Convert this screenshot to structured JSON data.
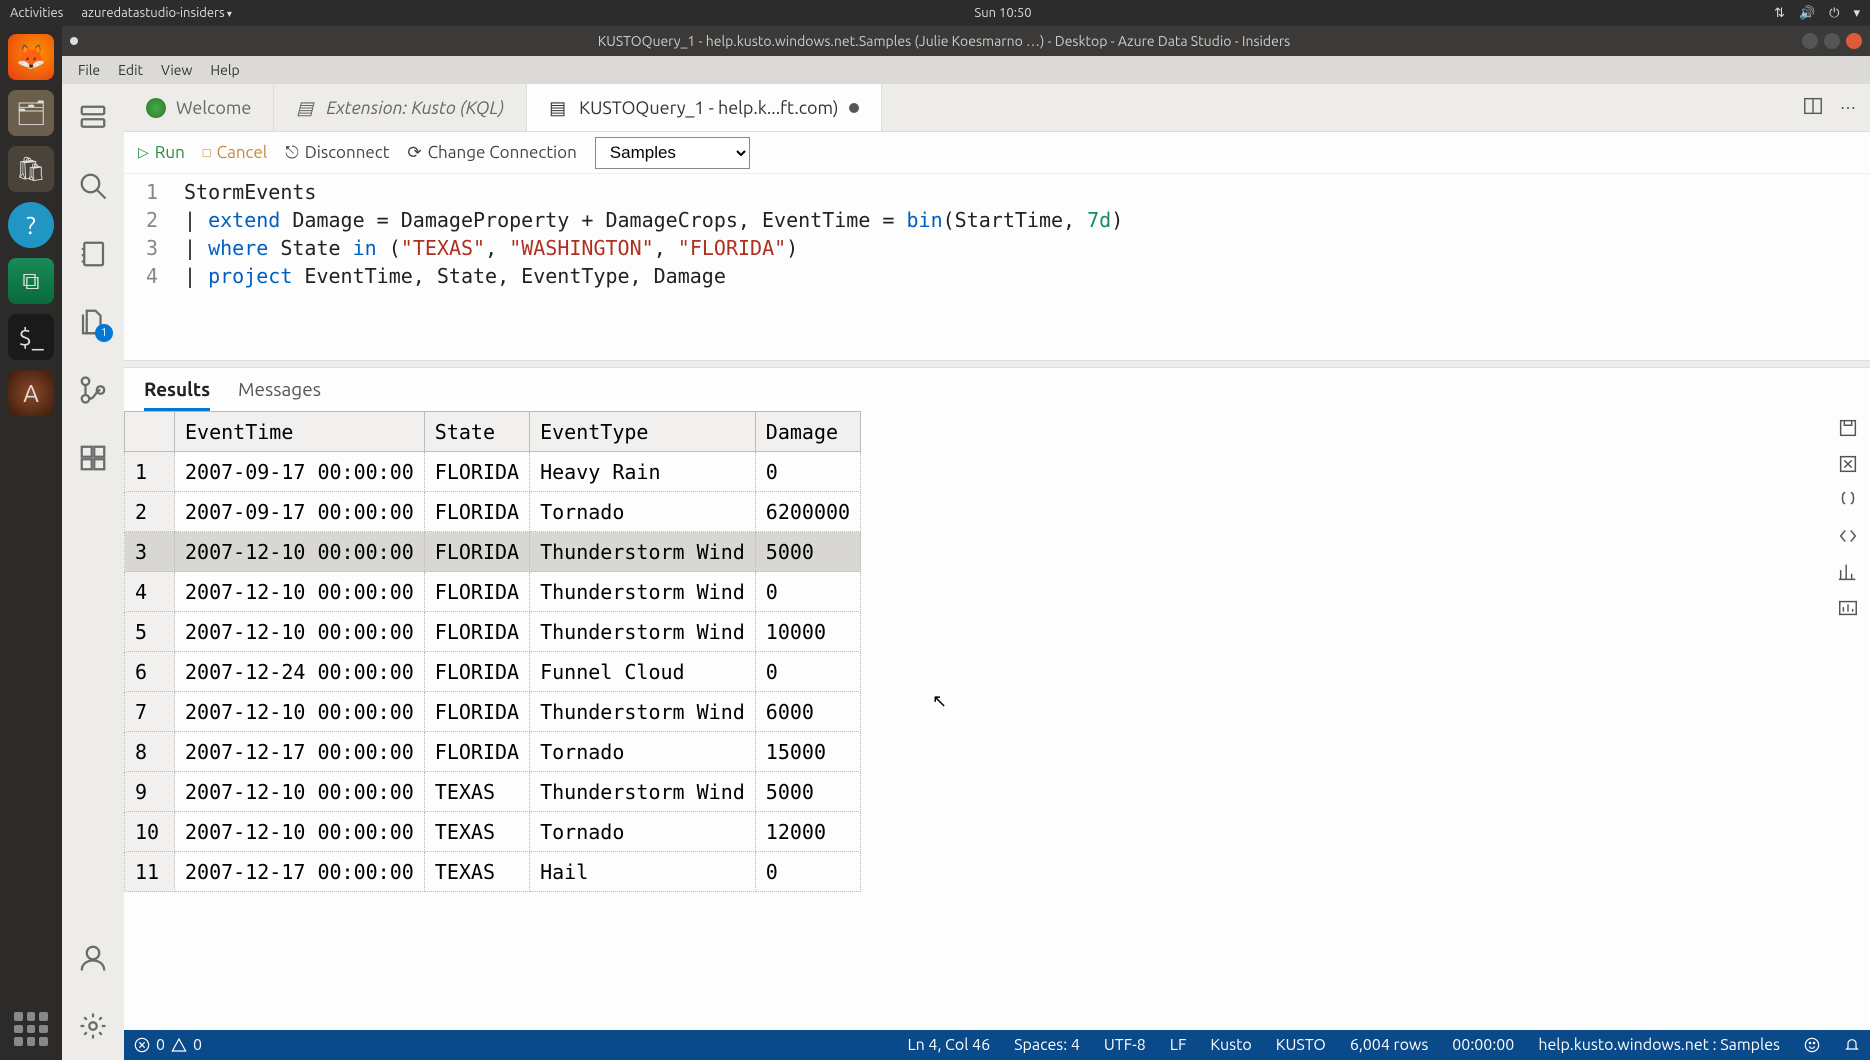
{
  "gnome": {
    "activities": "Activities",
    "app_menu": "azuredatastudio-insiders",
    "clock": "Sun 10:50"
  },
  "window": {
    "title": "KUSTOQuery_1 - help.kusto.windows.net.Samples (Julie Koesmarno …) - Desktop - Azure Data Studio - Insiders"
  },
  "menubar": [
    "File",
    "Edit",
    "View",
    "Help"
  ],
  "tabs": [
    {
      "label": "Welcome",
      "italic": false,
      "active": false,
      "dirty": false
    },
    {
      "label": "Extension: Kusto (KQL)",
      "italic": true,
      "active": false,
      "dirty": false
    },
    {
      "label": "KUSTOQuery_1 - help.k...ft.com)",
      "italic": false,
      "active": true,
      "dirty": true
    }
  ],
  "toolbar": {
    "run": "Run",
    "cancel": "Cancel",
    "disconnect": "Disconnect",
    "change_conn": "Change Connection",
    "db": "Samples"
  },
  "code_lines_raw": [
    "StormEvents",
    "| extend Damage = DamageProperty + DamageCrops, EventTime = bin(StartTime, 7d)",
    "| where State in (\"TEXAS\", \"WASHINGTON\", \"FLORIDA\")",
    "| project EventTime, State, EventType, Damage"
  ],
  "result_tabs": {
    "results": "Results",
    "messages": "Messages"
  },
  "grid": {
    "columns": [
      "EventTime",
      "State",
      "EventType",
      "Damage"
    ],
    "rows": [
      [
        "2007-09-17 00:00:00",
        "FLORIDA",
        "Heavy Rain",
        "0"
      ],
      [
        "2007-09-17 00:00:00",
        "FLORIDA",
        "Tornado",
        "6200000"
      ],
      [
        "2007-12-10 00:00:00",
        "FLORIDA",
        "Thunderstorm Wind",
        "5000"
      ],
      [
        "2007-12-10 00:00:00",
        "FLORIDA",
        "Thunderstorm Wind",
        "0"
      ],
      [
        "2007-12-10 00:00:00",
        "FLORIDA",
        "Thunderstorm Wind",
        "10000"
      ],
      [
        "2007-12-24 00:00:00",
        "FLORIDA",
        "Funnel Cloud",
        "0"
      ],
      [
        "2007-12-10 00:00:00",
        "FLORIDA",
        "Thunderstorm Wind",
        "6000"
      ],
      [
        "2007-12-17 00:00:00",
        "FLORIDA",
        "Tornado",
        "15000"
      ],
      [
        "2007-12-10 00:00:00",
        "TEXAS",
        "Thunderstorm Wind",
        "5000"
      ],
      [
        "2007-12-10 00:00:00",
        "TEXAS",
        "Tornado",
        "12000"
      ],
      [
        "2007-12-17 00:00:00",
        "TEXAS",
        "Hail",
        "0"
      ]
    ],
    "selected_row_index": 2
  },
  "statusbar": {
    "errors": "0",
    "warnings": "0",
    "cursor": "Ln 4, Col 46",
    "spaces": "Spaces: 4",
    "encoding": "UTF-8",
    "eol": "LF",
    "lang": "Kusto",
    "conn_type": "KUSTO",
    "rows": "6,004 rows",
    "elapsed": "00:00:00",
    "server": "help.kusto.windows.net : Samples"
  }
}
